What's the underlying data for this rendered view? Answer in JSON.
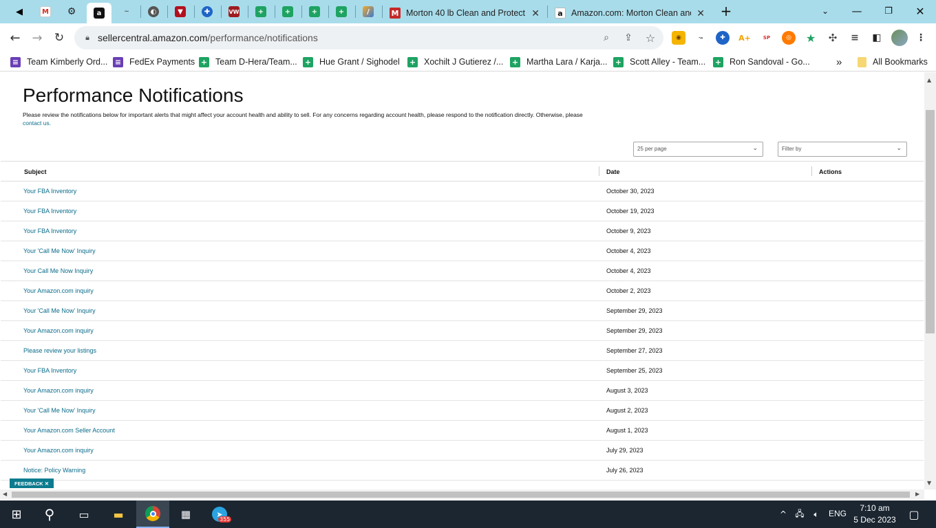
{
  "browser": {
    "tabs": [
      {
        "title": "Morton 40 lb Clean and Protect",
        "icon": "morton-icon"
      },
      {
        "title": "Amazon.com: Morton Clean and",
        "icon": "amazon-icon"
      }
    ],
    "new_tab": "+",
    "url": {
      "host": "sellercentral.amazon.com",
      "path": "/performance/notifications"
    }
  },
  "bookmarks": [
    {
      "label": "Team Kimberly Ord...",
      "color": "#6a3fb5"
    },
    {
      "label": "FedEx Payments",
      "color": "#6a3fb5"
    },
    {
      "label": "Team D-Hera/Team...",
      "color": "#1ea362"
    },
    {
      "label": "Hue Grant / Sighodel",
      "color": "#1ea362"
    },
    {
      "label": "Xochilt J Gutierez /...",
      "color": "#1ea362"
    },
    {
      "label": "Martha Lara / Karja...",
      "color": "#1ea362"
    },
    {
      "label": "Scott Alley - Team...",
      "color": "#1ea362"
    },
    {
      "label": "Ron Sandoval - Go...",
      "color": "#1ea362"
    }
  ],
  "bookmarks_more": "»",
  "all_bookmarks": "All Bookmarks",
  "page": {
    "title": "Performance Notifications",
    "intro": "Please review the notifications below for important alerts that might affect your account health and ability to sell. For any concerns regarding account health, please respond to the notification directly. Otherwise, please",
    "contact_link": "contact us.",
    "per_page": "25 per page",
    "filter_placeholder": "Filter by",
    "columns": {
      "subject": "Subject",
      "date": "Date",
      "actions": "Actions"
    },
    "rows": [
      {
        "subject": "Your FBA Inventory",
        "date": "October 30, 2023"
      },
      {
        "subject": "Your FBA Inventory",
        "date": "October 19, 2023"
      },
      {
        "subject": "Your FBA Inventory",
        "date": "October 9, 2023"
      },
      {
        "subject": "Your 'Call Me Now' Inquiry",
        "date": "October 4, 2023"
      },
      {
        "subject": "Your Call Me Now Inquiry",
        "date": "October 4, 2023"
      },
      {
        "subject": "Your Amazon.com inquiry",
        "date": "October 2, 2023"
      },
      {
        "subject": "Your 'Call Me Now' Inquiry",
        "date": "September 29, 2023"
      },
      {
        "subject": "Your Amazon.com inquiry",
        "date": "September 29, 2023"
      },
      {
        "subject": "Please review your listings",
        "date": "September 27, 2023"
      },
      {
        "subject": "Your FBA Inventory",
        "date": "September 25, 2023"
      },
      {
        "subject": "Your Amazon.com inquiry",
        "date": "August 3, 2023"
      },
      {
        "subject": "Your 'Call Me Now' Inquiry",
        "date": "August 2, 2023"
      },
      {
        "subject": "Your Amazon.com Seller Account",
        "date": "August 1, 2023"
      },
      {
        "subject": "Your Amazon.com inquiry",
        "date": "July 29, 2023"
      },
      {
        "subject": "Notice: Policy Warning",
        "date": "July 26, 2023"
      }
    ],
    "feedback": "FEEDBACK ✕"
  },
  "taskbar": {
    "language": "ENG",
    "time": "7:10 am",
    "date": "5 Dec 2023",
    "telegram_badge": "355"
  }
}
